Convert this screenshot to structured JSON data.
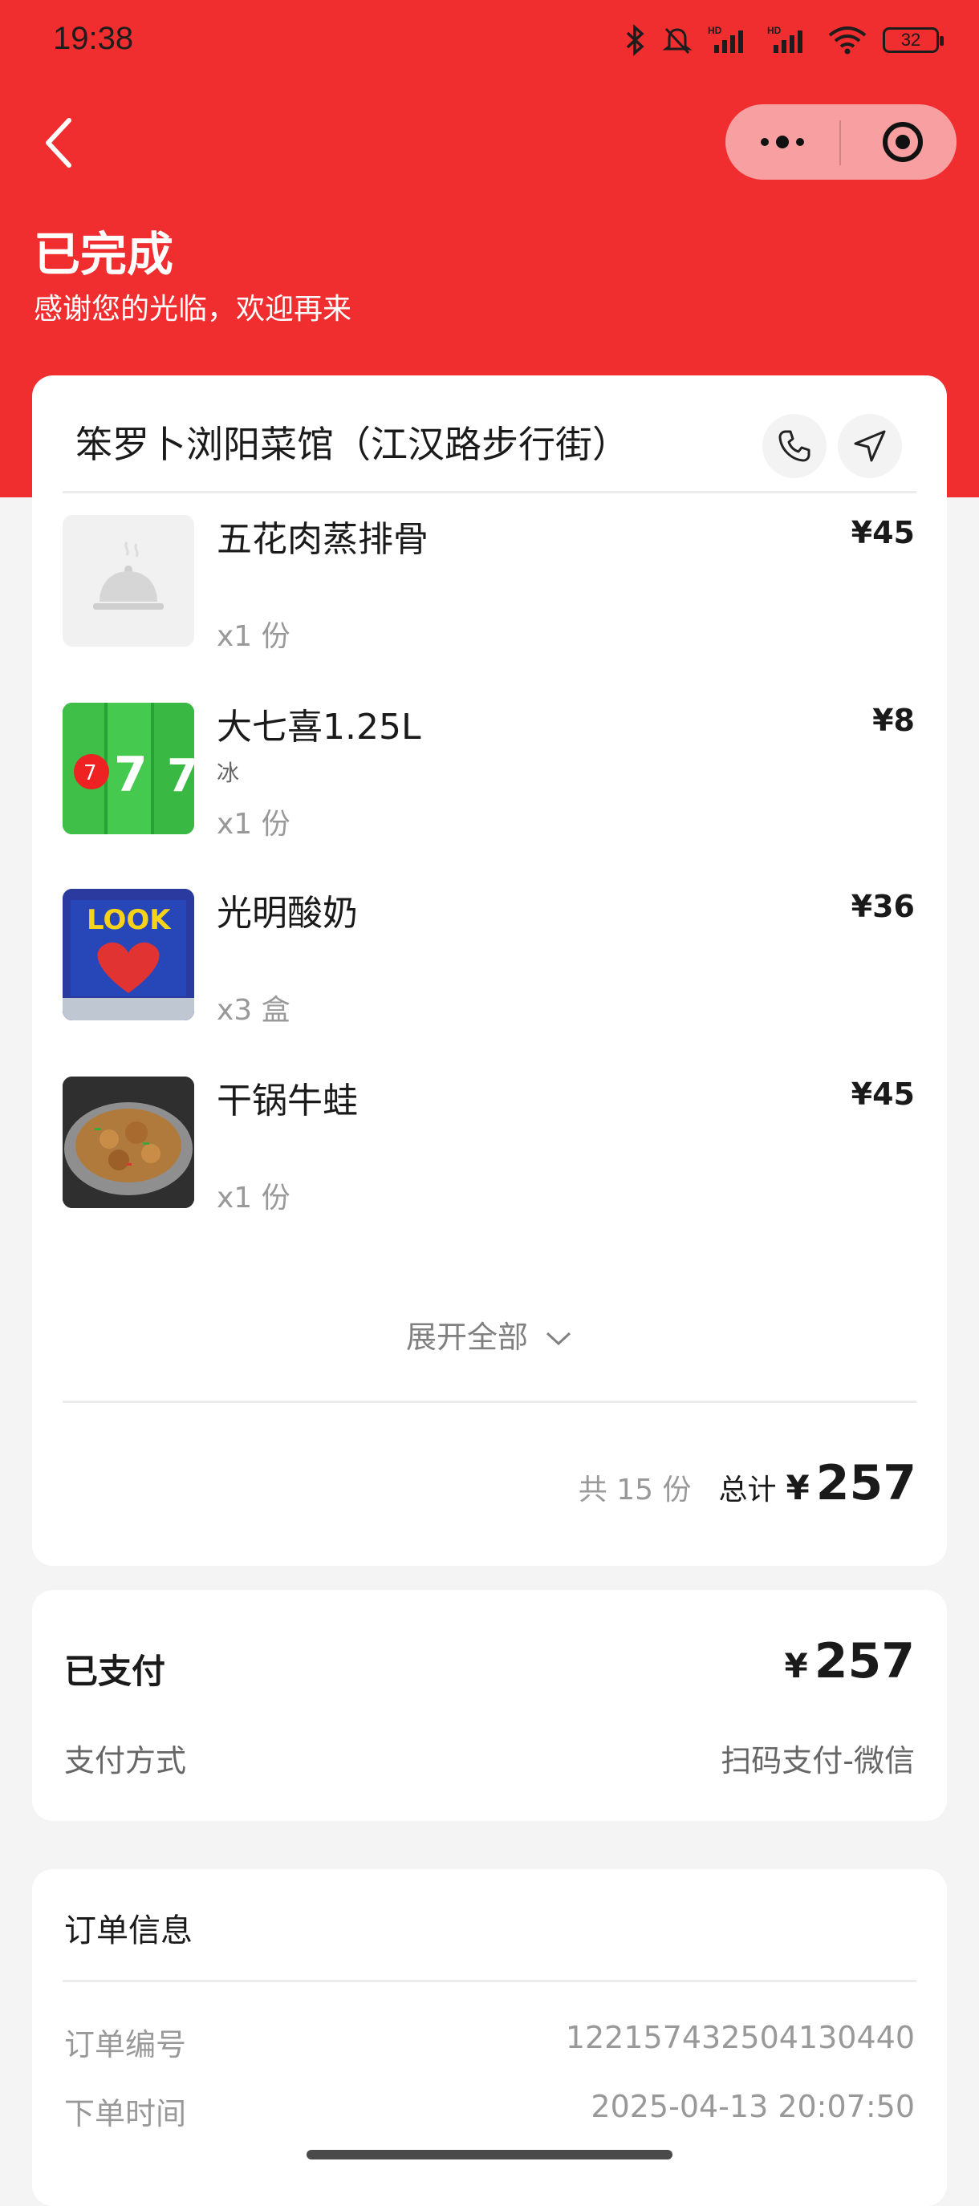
{
  "status_bar": {
    "time": "19:38",
    "battery": "32",
    "icons": [
      "bluetooth-icon",
      "bell-muted-icon",
      "signal-hd-icon",
      "signal-hd-icon",
      "wifi-icon",
      "battery-icon"
    ]
  },
  "header": {
    "title": "已完成",
    "subtitle": "感谢您的光临，欢迎再来",
    "theme_color": "#f02d2f"
  },
  "shop": {
    "name": "笨罗卜浏阳菜馆（江汉路步行街）"
  },
  "items": [
    {
      "name": "五花肉蒸排骨",
      "spec": "",
      "qty": "x1 份",
      "price": "¥45",
      "image": "placeholder-dish"
    },
    {
      "name": "大七喜1.25L",
      "spec": "冰",
      "qty": "x1 份",
      "price": "¥8",
      "image": "7up-bottles"
    },
    {
      "name": "光明酸奶",
      "spec": "",
      "qty": "x3 盒",
      "price": "¥36",
      "image": "yogurt-box"
    },
    {
      "name": "干锅牛蛙",
      "spec": "",
      "qty": "x1 份",
      "price": "¥45",
      "image": "frog-dish"
    }
  ],
  "expand_label": "展开全部",
  "summary": {
    "count_text": "共 15 份",
    "total_label": "总计",
    "currency": "¥",
    "total": "257"
  },
  "payment": {
    "paid_label": "已支付",
    "currency": "¥",
    "amount": "257",
    "method_label": "支付方式",
    "method_value": "扫码支付-微信"
  },
  "order_info": {
    "title": "订单信息",
    "number_label": "订单编号",
    "number_value": "1221574325041304​40",
    "time_label": "下单时间",
    "time_value": "2025-04-13 20:07:50"
  }
}
